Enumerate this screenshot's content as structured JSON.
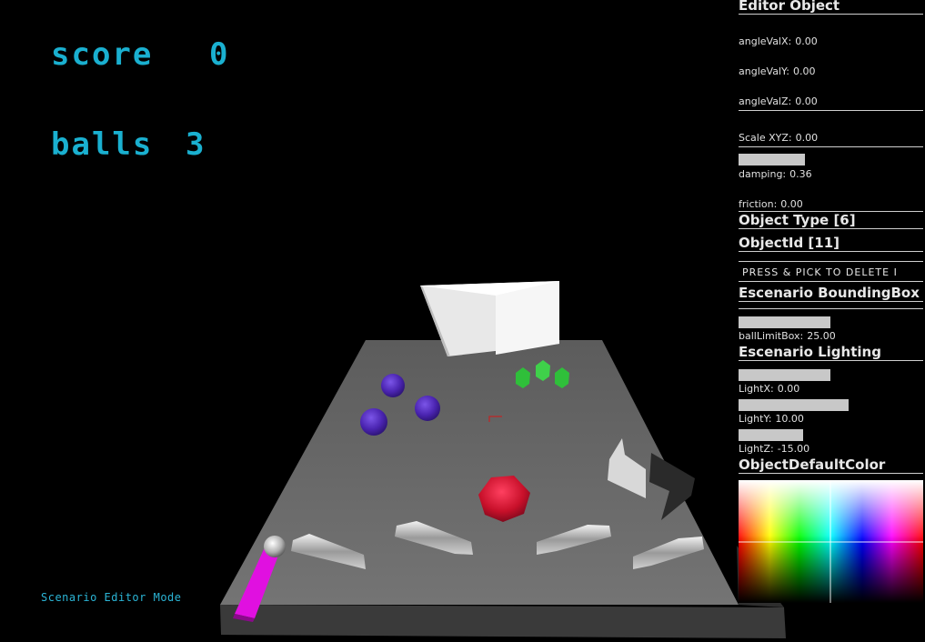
{
  "hud": {
    "score_label": "score",
    "score_value": "0",
    "balls_label": "balls",
    "balls_value": "3",
    "mode": "Scenario Editor Mode"
  },
  "colors": {
    "hud_text": "#1ab0d0",
    "ball_color": "#5b2fc7",
    "bumper_color": "#d01530",
    "target_color": "#2fbf3a",
    "plunger_color": "#e010e0",
    "table_color": "#6e6e6e"
  },
  "panel": {
    "editor_object_title": "Editor Object",
    "angle_x_label": "angleValX:",
    "angle_x_value": "0.00",
    "angle_y_label": "angleValY:",
    "angle_y_value": "0.00",
    "angle_z_label": "angleValZ:",
    "angle_z_value": "0.00",
    "scale_label": "Scale XYZ:",
    "scale_value": "0.00",
    "damping_label": "damping:",
    "damping_value": "0.36",
    "damping_level": 0.36,
    "friction_label": "friction:",
    "friction_value": "0.00",
    "object_type": "Object Type [6]",
    "object_id": "ObjectId [11]",
    "press_pick_delete": "PRESS & PICK TO DELETE I",
    "bounding_box_title": "Escenario BoundingBox",
    "ball_limit_label": "ballLimitBox:",
    "ball_limit_value": "25.00",
    "lighting_title": "Escenario Lighting",
    "light_x_label": "LightX:",
    "light_x_value": "0.00",
    "light_y_label": "LightY:",
    "light_y_value": "10.00",
    "light_z_label": "LightZ:",
    "light_z_value": "-15.00",
    "default_color_title": "ObjectDefaultColor"
  }
}
